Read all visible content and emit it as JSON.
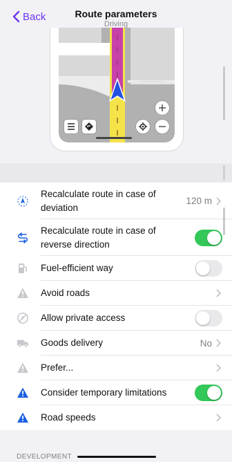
{
  "header": {
    "back_label": "Back",
    "title": "Route parameters",
    "subtitle": "Driving"
  },
  "settings": [
    {
      "label": "Recalculate route in case of deviation",
      "value": "120 m",
      "icon": "deviation-icon",
      "control": "chevron"
    },
    {
      "label": "Recalculate route in case of reverse direction",
      "icon": "reverse-direction-icon",
      "control": "toggle",
      "on": true
    },
    {
      "label": "Fuel-efficient way",
      "icon": "fuel-icon",
      "control": "toggle",
      "on": false
    },
    {
      "label": "Avoid roads",
      "icon": "warning-icon",
      "control": "chevron"
    },
    {
      "label": "Allow private access",
      "icon": "no-entry-icon",
      "control": "toggle",
      "on": false
    },
    {
      "label": "Goods delivery",
      "value": "No",
      "icon": "truck-icon",
      "control": "chevron"
    },
    {
      "label": "Prefer...",
      "icon": "warning-icon",
      "control": "chevron"
    },
    {
      "label": "Consider temporary limitations",
      "icon": "warning-blue-icon",
      "control": "toggle",
      "on": true
    },
    {
      "label": "Road speeds",
      "icon": "warning-blue-icon",
      "control": "chevron"
    }
  ],
  "footer": {
    "section_label": "DEVELOPMENT"
  },
  "colors": {
    "accent": "#6b35f0",
    "toggle_on": "#34c759",
    "route": "#c840a9",
    "road": "#f5e34a",
    "blue_icon": "#1a5fe0"
  }
}
